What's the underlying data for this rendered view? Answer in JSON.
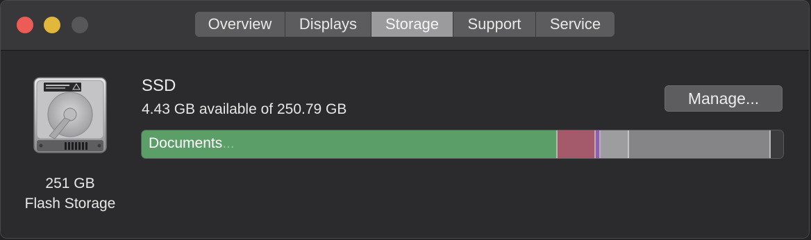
{
  "window": {
    "tabs": [
      {
        "label": "Overview",
        "active": false
      },
      {
        "label": "Displays",
        "active": false
      },
      {
        "label": "Storage",
        "active": true
      },
      {
        "label": "Support",
        "active": false
      },
      {
        "label": "Service",
        "active": false
      }
    ]
  },
  "disk": {
    "capacity_label": "251 GB",
    "type_label": "Flash Storage",
    "name": "SSD",
    "space_text": "4.43 GB available of 250.79 GB",
    "manage_label": "Manage..."
  },
  "storage_bar": {
    "hover_label": "Documents",
    "hover_label_trailing": "...",
    "segments": [
      {
        "name": "documents",
        "fraction": 0.648,
        "color": "#5b9e68"
      },
      {
        "name": "apps",
        "fraction": 0.06,
        "color": "#a45a6b"
      },
      {
        "name": "misc",
        "fraction": 0.008,
        "color": "#8e5fae"
      },
      {
        "name": "system-light",
        "fraction": 0.044,
        "color": "#9d9d9f"
      },
      {
        "name": "other",
        "fraction": 0.221,
        "color": "#858587"
      },
      {
        "name": "free",
        "fraction": 0.019,
        "color": "#3b3b3d"
      }
    ]
  },
  "colors": {
    "accent_green": "#5b9e68",
    "titlebar": "#38383a",
    "content": "#2b2b2d"
  }
}
